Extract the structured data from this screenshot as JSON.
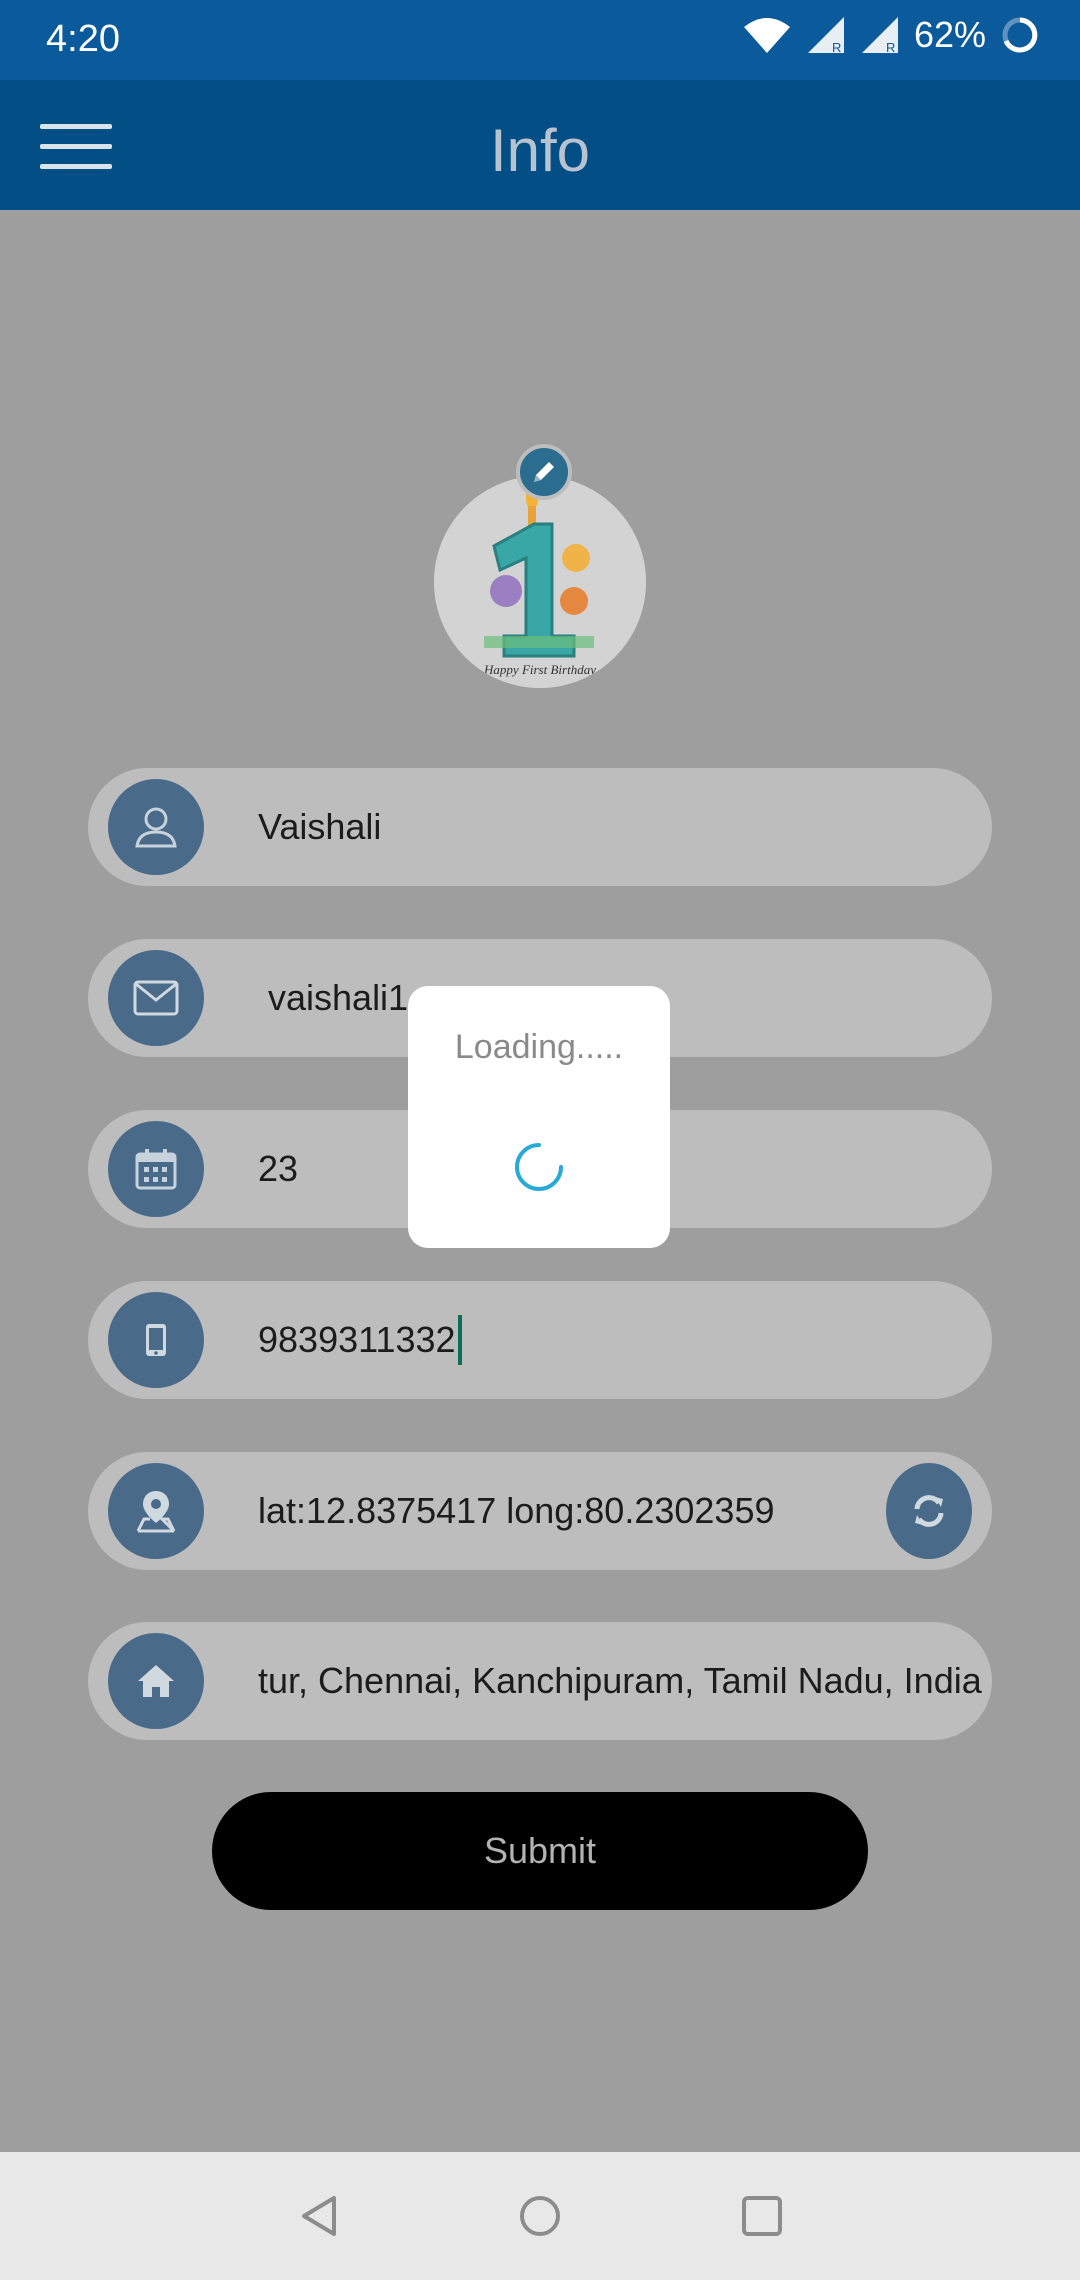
{
  "status_bar": {
    "time": "4:20",
    "battery": "62%",
    "icons": [
      "wifi-icon",
      "signal-r-icon",
      "signal-r-icon",
      "battery-ring-icon"
    ]
  },
  "app_bar": {
    "title": "Info",
    "menu_icon": "hamburger-menu-icon"
  },
  "profile": {
    "avatar_icon": "first-birthday-image",
    "avatar_caption": "Happy First Birthday",
    "edit_icon": "pencil-icon"
  },
  "form": {
    "name": "Vaishali",
    "email": "vaishali1",
    "age": "23",
    "phone": "9839311332",
    "location": "lat:12.8375417 long:80.2302359",
    "address": "tur, Chennai, Kanchipuram, Tamil Nadu, India",
    "icons": {
      "name": "user-icon",
      "email": "mail-icon",
      "age": "calendar-icon",
      "phone": "mobile-icon",
      "location": "map-pin-icon",
      "refresh": "refresh-icon",
      "address": "home-icon"
    }
  },
  "submit_label": "Submit",
  "loading_dialog": {
    "text": "Loading.....",
    "spinner_color": "#29a9d6"
  },
  "colors": {
    "status_bar": "#0a5a9c",
    "app_bar": "#044e86",
    "icon_circle": "#4a6a8a",
    "field_bg": "#bdbdbd",
    "scrim_bg": "#9e9e9e"
  },
  "nav_bar": {
    "icons": [
      "back-triangle-icon",
      "home-circle-icon",
      "recents-square-icon"
    ]
  }
}
